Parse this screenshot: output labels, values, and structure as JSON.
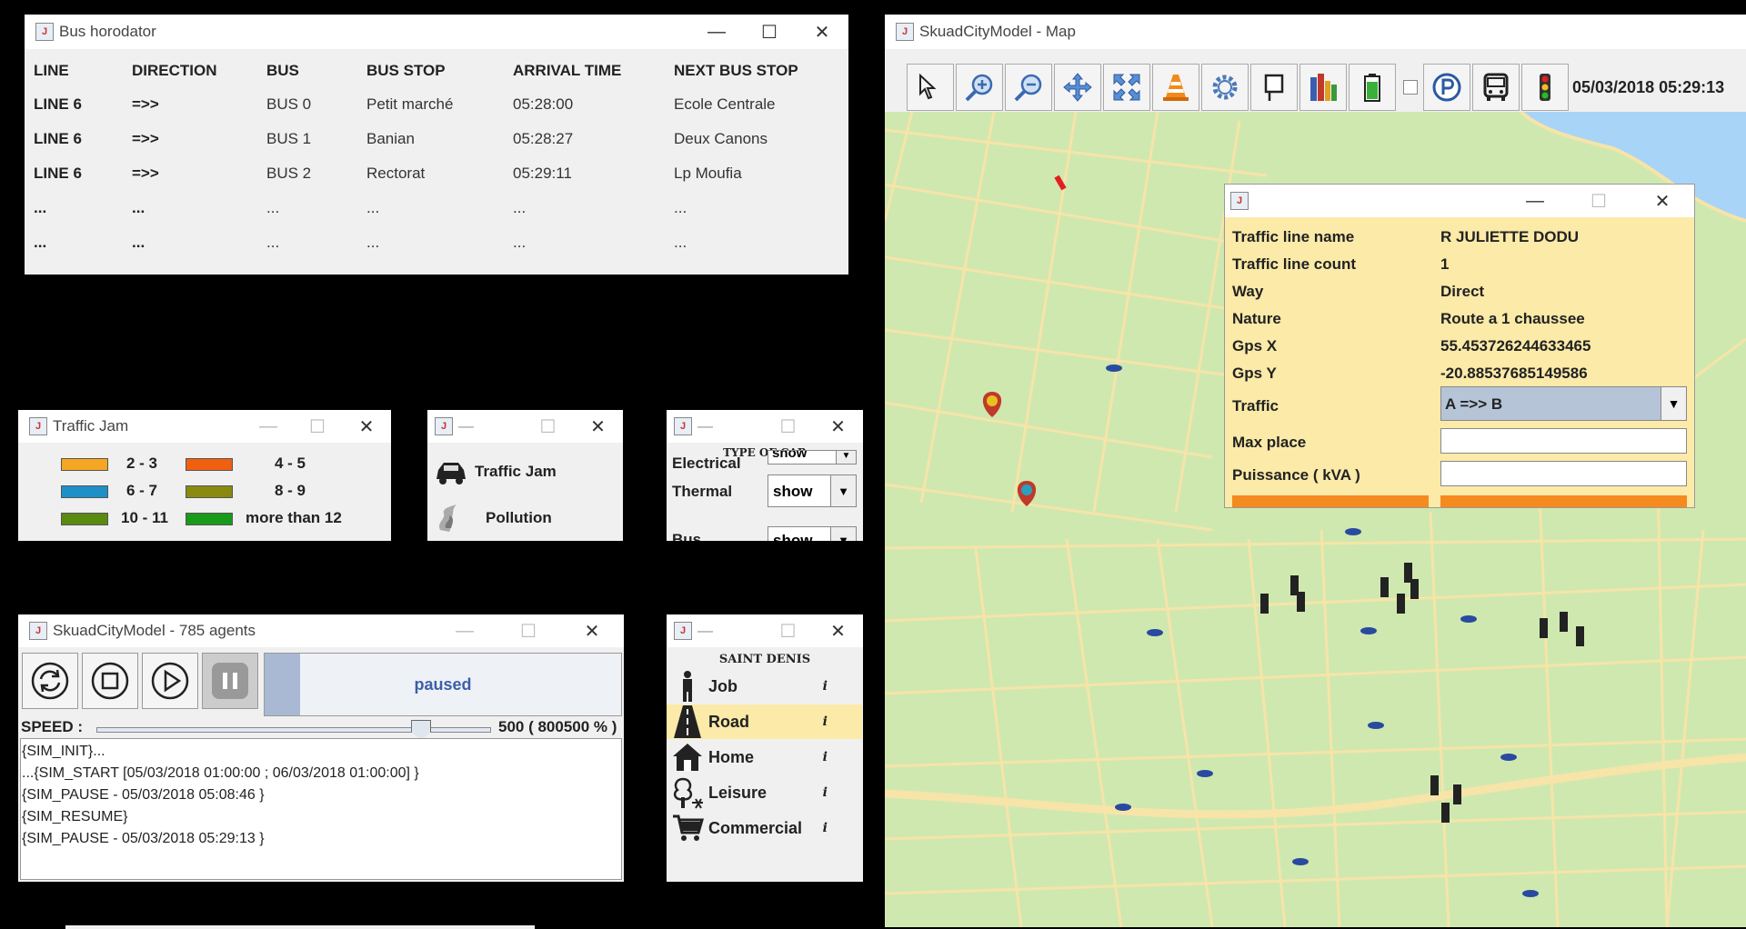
{
  "bus_window": {
    "title": "Bus horodator",
    "columns": [
      "LINE",
      "DIRECTION",
      "BUS",
      "BUS STOP",
      "ARRIVAL TIME",
      "NEXT BUS STOP"
    ],
    "rows": [
      [
        "LINE 6",
        "=>>",
        "BUS 0",
        "Petit marché",
        "05:28:00",
        "Ecole Centrale"
      ],
      [
        "LINE 6",
        "=>>",
        "BUS 1",
        "Banian",
        "05:28:27",
        "Deux Canons"
      ],
      [
        "LINE 6",
        "=>>",
        "BUS 2",
        "Rectorat",
        "05:29:11",
        "Lp Moufia"
      ],
      [
        "...",
        "...",
        "...",
        "...",
        "...",
        "..."
      ],
      [
        "...",
        "...",
        "...",
        "...",
        "...",
        "..."
      ]
    ]
  },
  "traffic_jam_window": {
    "title": "Traffic Jam",
    "legend": [
      {
        "label": "2 - 3",
        "color": "#f5a623"
      },
      {
        "label": "4 - 5",
        "color": "#f06010"
      },
      {
        "label": "6 - 7",
        "color": "#1e90c8"
      },
      {
        "label": "8 - 9",
        "color": "#8a8a10"
      },
      {
        "label": "10 - 11",
        "color": "#5a8a10"
      },
      {
        "label": "more than 12",
        "color": "#1a9a1a"
      }
    ]
  },
  "layers_window": {
    "items": [
      {
        "label": "Traffic Jam",
        "icon": "car-icon"
      },
      {
        "label": "Pollution",
        "icon": "smoke-icon"
      }
    ]
  },
  "type_car_window": {
    "heading": "TYPE OF CAR",
    "rows": [
      {
        "label": "Electrical",
        "value": "show"
      },
      {
        "label": "Thermal",
        "value": "show"
      },
      {
        "label": "Bus",
        "value": "show"
      }
    ]
  },
  "sim_window": {
    "title": "SkuadCityModel - 785 agents",
    "status": "paused",
    "progress": 0.1,
    "speed_label": "SPEED :",
    "speed_value": "500 ( 800500 % )",
    "speed_fraction": 0.84,
    "log": [
      "{SIM_INIT}...",
      "...{SIM_START [05/03/2018 01:00:00 ; 06/03/2018 01:00:00] }",
      "{SIM_PAUSE - 05/03/2018 05:08:46 }",
      "{SIM_RESUME}",
      "{SIM_PAUSE - 05/03/2018 05:29:13 }"
    ]
  },
  "zone_window": {
    "heading": "SAINT DENIS",
    "items": [
      {
        "label": "Job",
        "icon": "worker-icon",
        "info": "i",
        "selected": false
      },
      {
        "label": "Road",
        "icon": "road-icon",
        "info": "i",
        "selected": true
      },
      {
        "label": "Home",
        "icon": "home-icon",
        "info": "i",
        "selected": false
      },
      {
        "label": "Leisure",
        "icon": "tree-icon",
        "info": "i",
        "selected": false
      },
      {
        "label": "Commercial",
        "icon": "cart-icon",
        "info": "i",
        "selected": false
      }
    ]
  },
  "map_window": {
    "title": "SkuadCityModel -  Map",
    "datetime": "05/03/2018 05:29:13",
    "toolbar": [
      "pointer-icon",
      "zoom-in-icon",
      "zoom-out-icon",
      "pan-icon",
      "fit-icon",
      "cone-icon",
      "gear-icon",
      "pin-icon",
      "buildings-icon",
      "battery-icon",
      "parking-icon",
      "bus-icon",
      "traffic-light-icon"
    ]
  },
  "info_window": {
    "fields": [
      {
        "label": "Traffic line name",
        "value": "R JULIETTE DODU"
      },
      {
        "label": "Traffic line count",
        "value": "1"
      },
      {
        "label": "Way",
        "value": "Direct"
      },
      {
        "label": "Nature",
        "value": "Route a 1 chaussee"
      },
      {
        "label": "Gps X",
        "value": "55.453726244633465"
      },
      {
        "label": "Gps Y",
        "value": "-20.88537685149586"
      }
    ],
    "traffic_label": "Traffic",
    "traffic_value": "A =>> B",
    "max_place_label": "Max place",
    "max_place_value": "",
    "puissance_label": "Puissance ( kVA )",
    "puissance_value": ""
  },
  "colors": {
    "map_bg": "#cfe8b0",
    "water": "#a8d4f8",
    "road": "#f7e4a8",
    "info_bg": "#fbeaa8",
    "accent_orange": "#f58a1f",
    "selected_row": "#fbeaa8"
  }
}
